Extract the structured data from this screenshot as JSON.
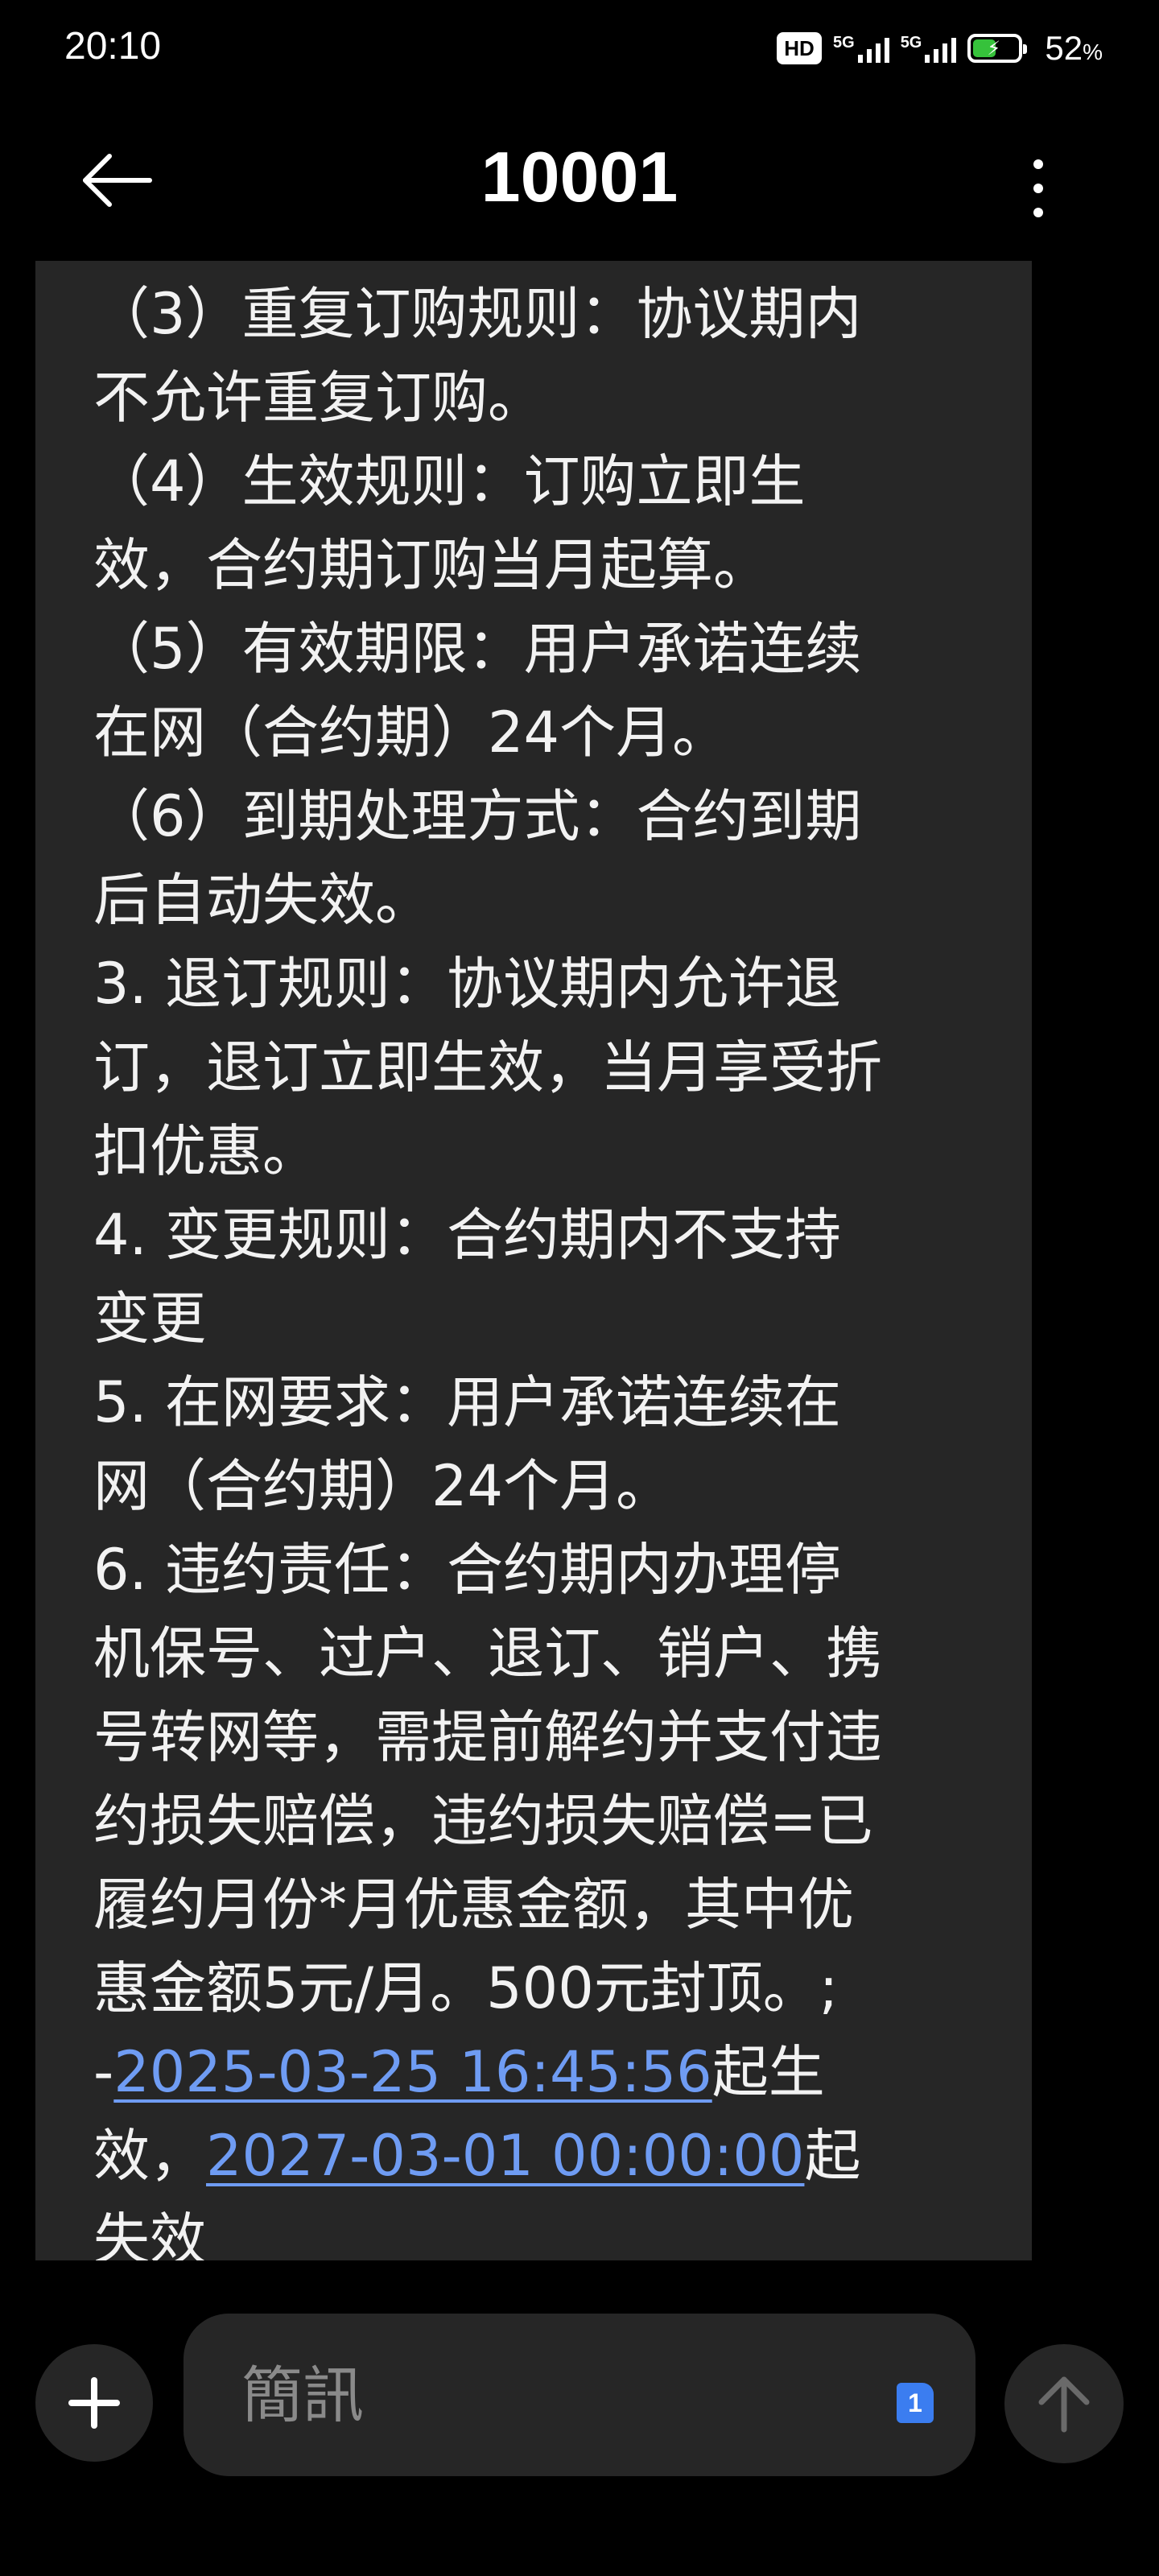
{
  "status_bar": {
    "time": "20:10",
    "hd_label": "HD",
    "network_1": "5G",
    "network_2": "5G",
    "battery_percent": "52",
    "battery_unit": "%",
    "battery_level": 0.52,
    "battery_color": "#36c23b"
  },
  "header": {
    "title": "10001",
    "back_icon": "arrow-left-icon",
    "more_icon": "more-vertical-icon"
  },
  "message": {
    "lines": [
      "（3）重复订购规则：协议期内",
      "不允许重复订购。",
      "（4）生效规则：订购立即生",
      "效，合约期订购当月起算。",
      "（5）有效期限：用户承诺连续",
      "在网（合约期）24个月。",
      "（6）到期处理方式：合约到期",
      "后自动失效。",
      "3. 退订规则：协议期内允许退",
      "订，退订立即生效，当月享受折",
      "扣优惠。",
      "4. 变更规则：合约期内不支持",
      "变更",
      "5. 在网要求：用户承诺连续在",
      "网（合约期）24个月。",
      "6.  违约责任：合约期内办理停",
      "机保号、过户、退订、销户、携",
      "号转网等，需提前解约并支付违",
      "约损失赔偿，违约损失赔偿=已",
      "履约月份*月优惠金额，其中优",
      "惠金额5元/月。500元封顶。;"
    ],
    "start_prefix": "-",
    "start_datetime": "2025-03-25 16:45:56",
    "start_suffix": "起生",
    "end_prefix": "效，",
    "end_datetime": "2027-03-01 00:00:00",
    "end_suffix": "起",
    "last_line": "失效",
    "link_color": "#6f9cf3",
    "bubble_color": "#262626"
  },
  "composer": {
    "placeholder": "簡訊",
    "sim_badge": "1",
    "add_icon": "plus-icon",
    "send_icon": "arrow-up-icon"
  }
}
